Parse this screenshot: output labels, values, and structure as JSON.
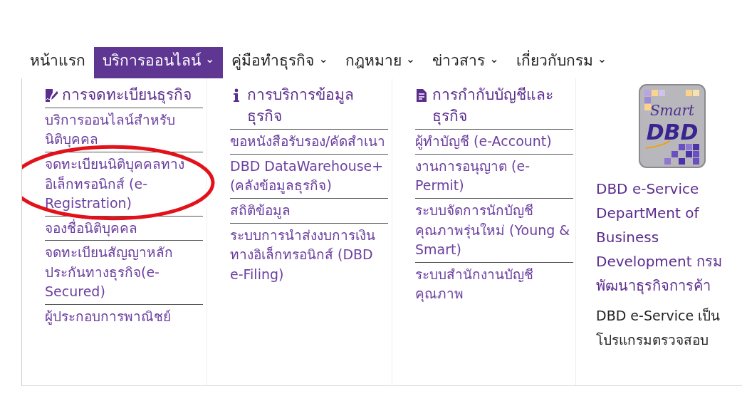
{
  "nav": [
    {
      "label": "หน้าแรก",
      "selected": false,
      "dropdown": false
    },
    {
      "label": "บริการออนไลน์",
      "selected": true,
      "dropdown": true
    },
    {
      "label": "คู่มือทำธุรกิจ",
      "selected": false,
      "dropdown": true
    },
    {
      "label": "กฎหมาย",
      "selected": false,
      "dropdown": true
    },
    {
      "label": "ข่าวสาร",
      "selected": false,
      "dropdown": true
    },
    {
      "label": "เกี่ยวกับกรม",
      "selected": false,
      "dropdown": true
    }
  ],
  "caret": "⌄",
  "columns": [
    {
      "title": "การจดทะเบียนธุรกิจ",
      "items": [
        {
          "label": "บริการออนไลน์สำหรับนิติบุคคล",
          "circled": false
        },
        {
          "label": "จดทะเบียนนิติบุคคลทางอิเล็กทรอนิกส์ (e-Registration)",
          "circled": true
        },
        {
          "label": "จองชื่อนิติบุคคล",
          "circled": false
        },
        {
          "label": "จดทะเบียนสัญญาหลักประกันทางธุรกิจ(e-Secured)",
          "circled": false
        },
        {
          "label": "ผู้ประกอบการพาณิชย์",
          "circled": false
        }
      ]
    },
    {
      "title": "การบริการข้อมูลธุรกิจ",
      "items": [
        {
          "label": "ขอหนังสือรับรอง/คัดสำเนา",
          "circled": false
        },
        {
          "label": "DBD DataWarehouse+ (คลังข้อมูลธุรกิจ)",
          "circled": false
        },
        {
          "label": "สถิติข้อมูล",
          "circled": false
        },
        {
          "label": "ระบบการนำส่งงบการเงินทางอิเล็กทรอนิกส์ (DBD e-Filing)",
          "circled": false
        }
      ]
    },
    {
      "title": "การกำกับบัญชีและธุรกิจ",
      "items": [
        {
          "label": "ผู้ทำบัญชี (e-Account)",
          "circled": false
        },
        {
          "label": "งานการอนุญาต (e-Permit)",
          "circled": false
        },
        {
          "label": "ระบบจัดการนักบัญชีคุณภาพรุ่นใหม่ (Young & Smart)",
          "circled": false
        },
        {
          "label": "ระบบสำนักงานบัญชีคุณภาพ",
          "circled": false
        }
      ]
    }
  ],
  "promo": {
    "logo_top": "Smart",
    "logo_main": "DBD",
    "title": "DBD e-Service DepartMent of Business Development กรมพัฒนาธุรกิจการค้า",
    "text": "DBD e-Service เป็นโปรแกรมตรวจสอบ"
  }
}
